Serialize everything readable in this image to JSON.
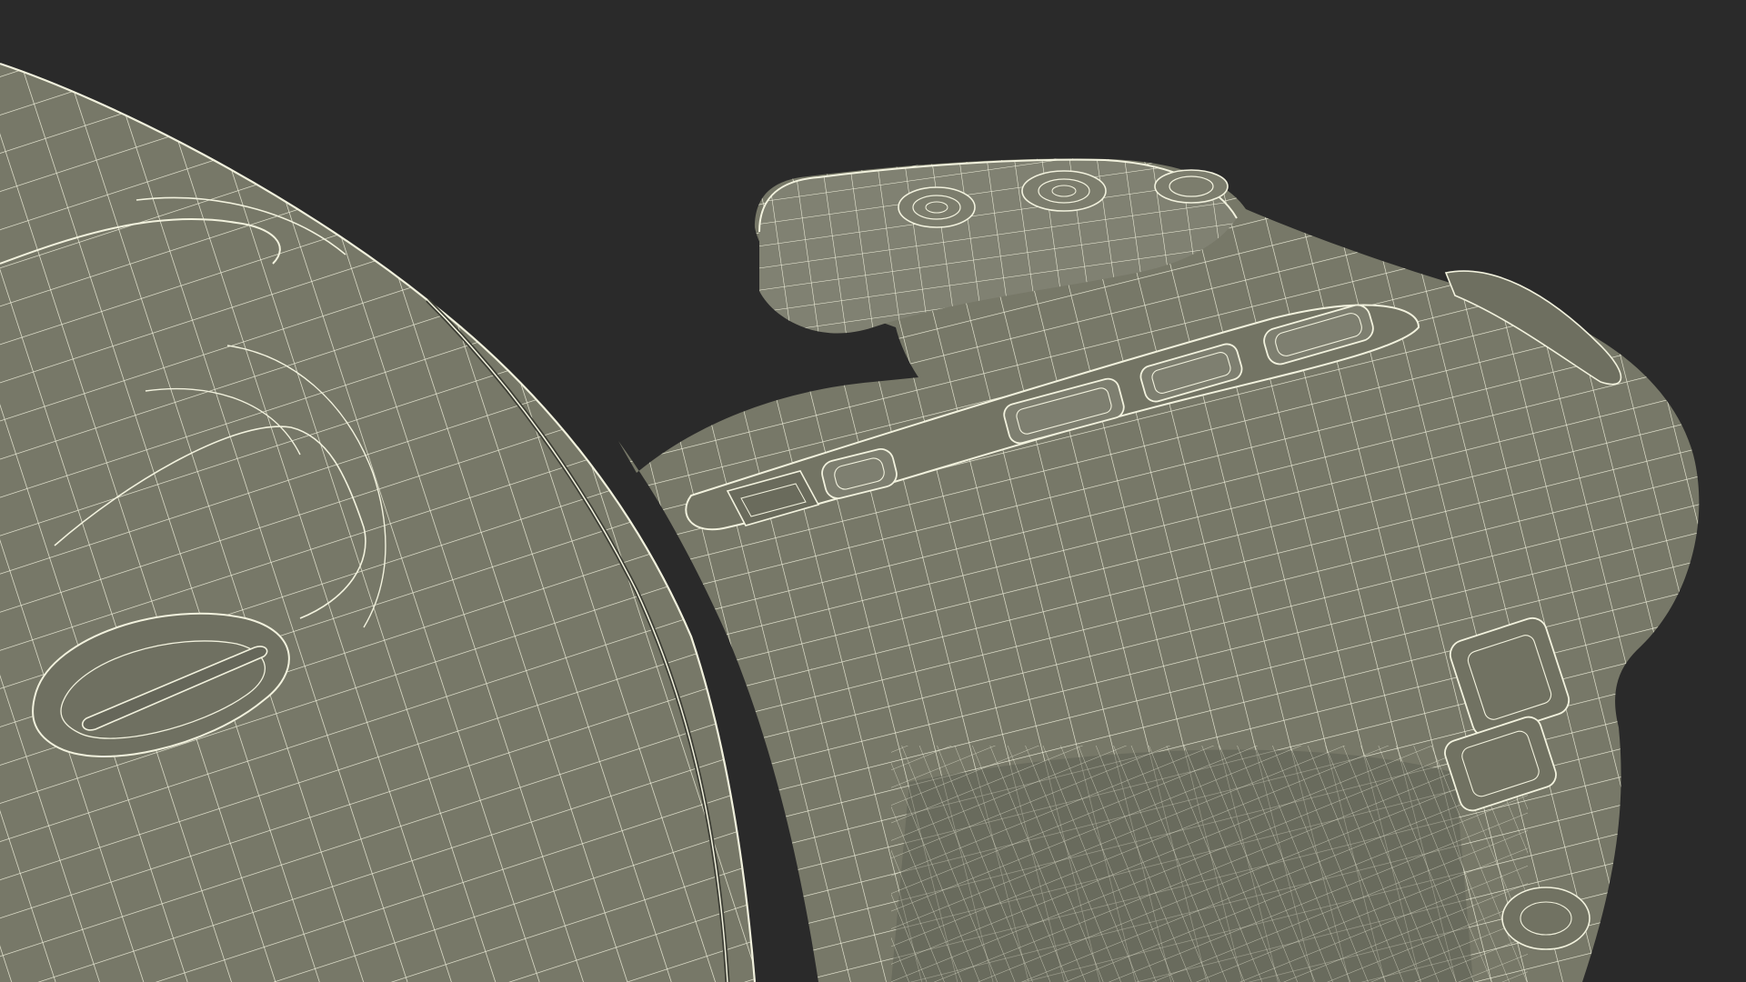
{
  "scene": {
    "background_color": "#2a2a2a",
    "surface_color": "#777868",
    "surface_shade_color": "#6b6c5d",
    "wire_color": "#f2f2de"
  }
}
